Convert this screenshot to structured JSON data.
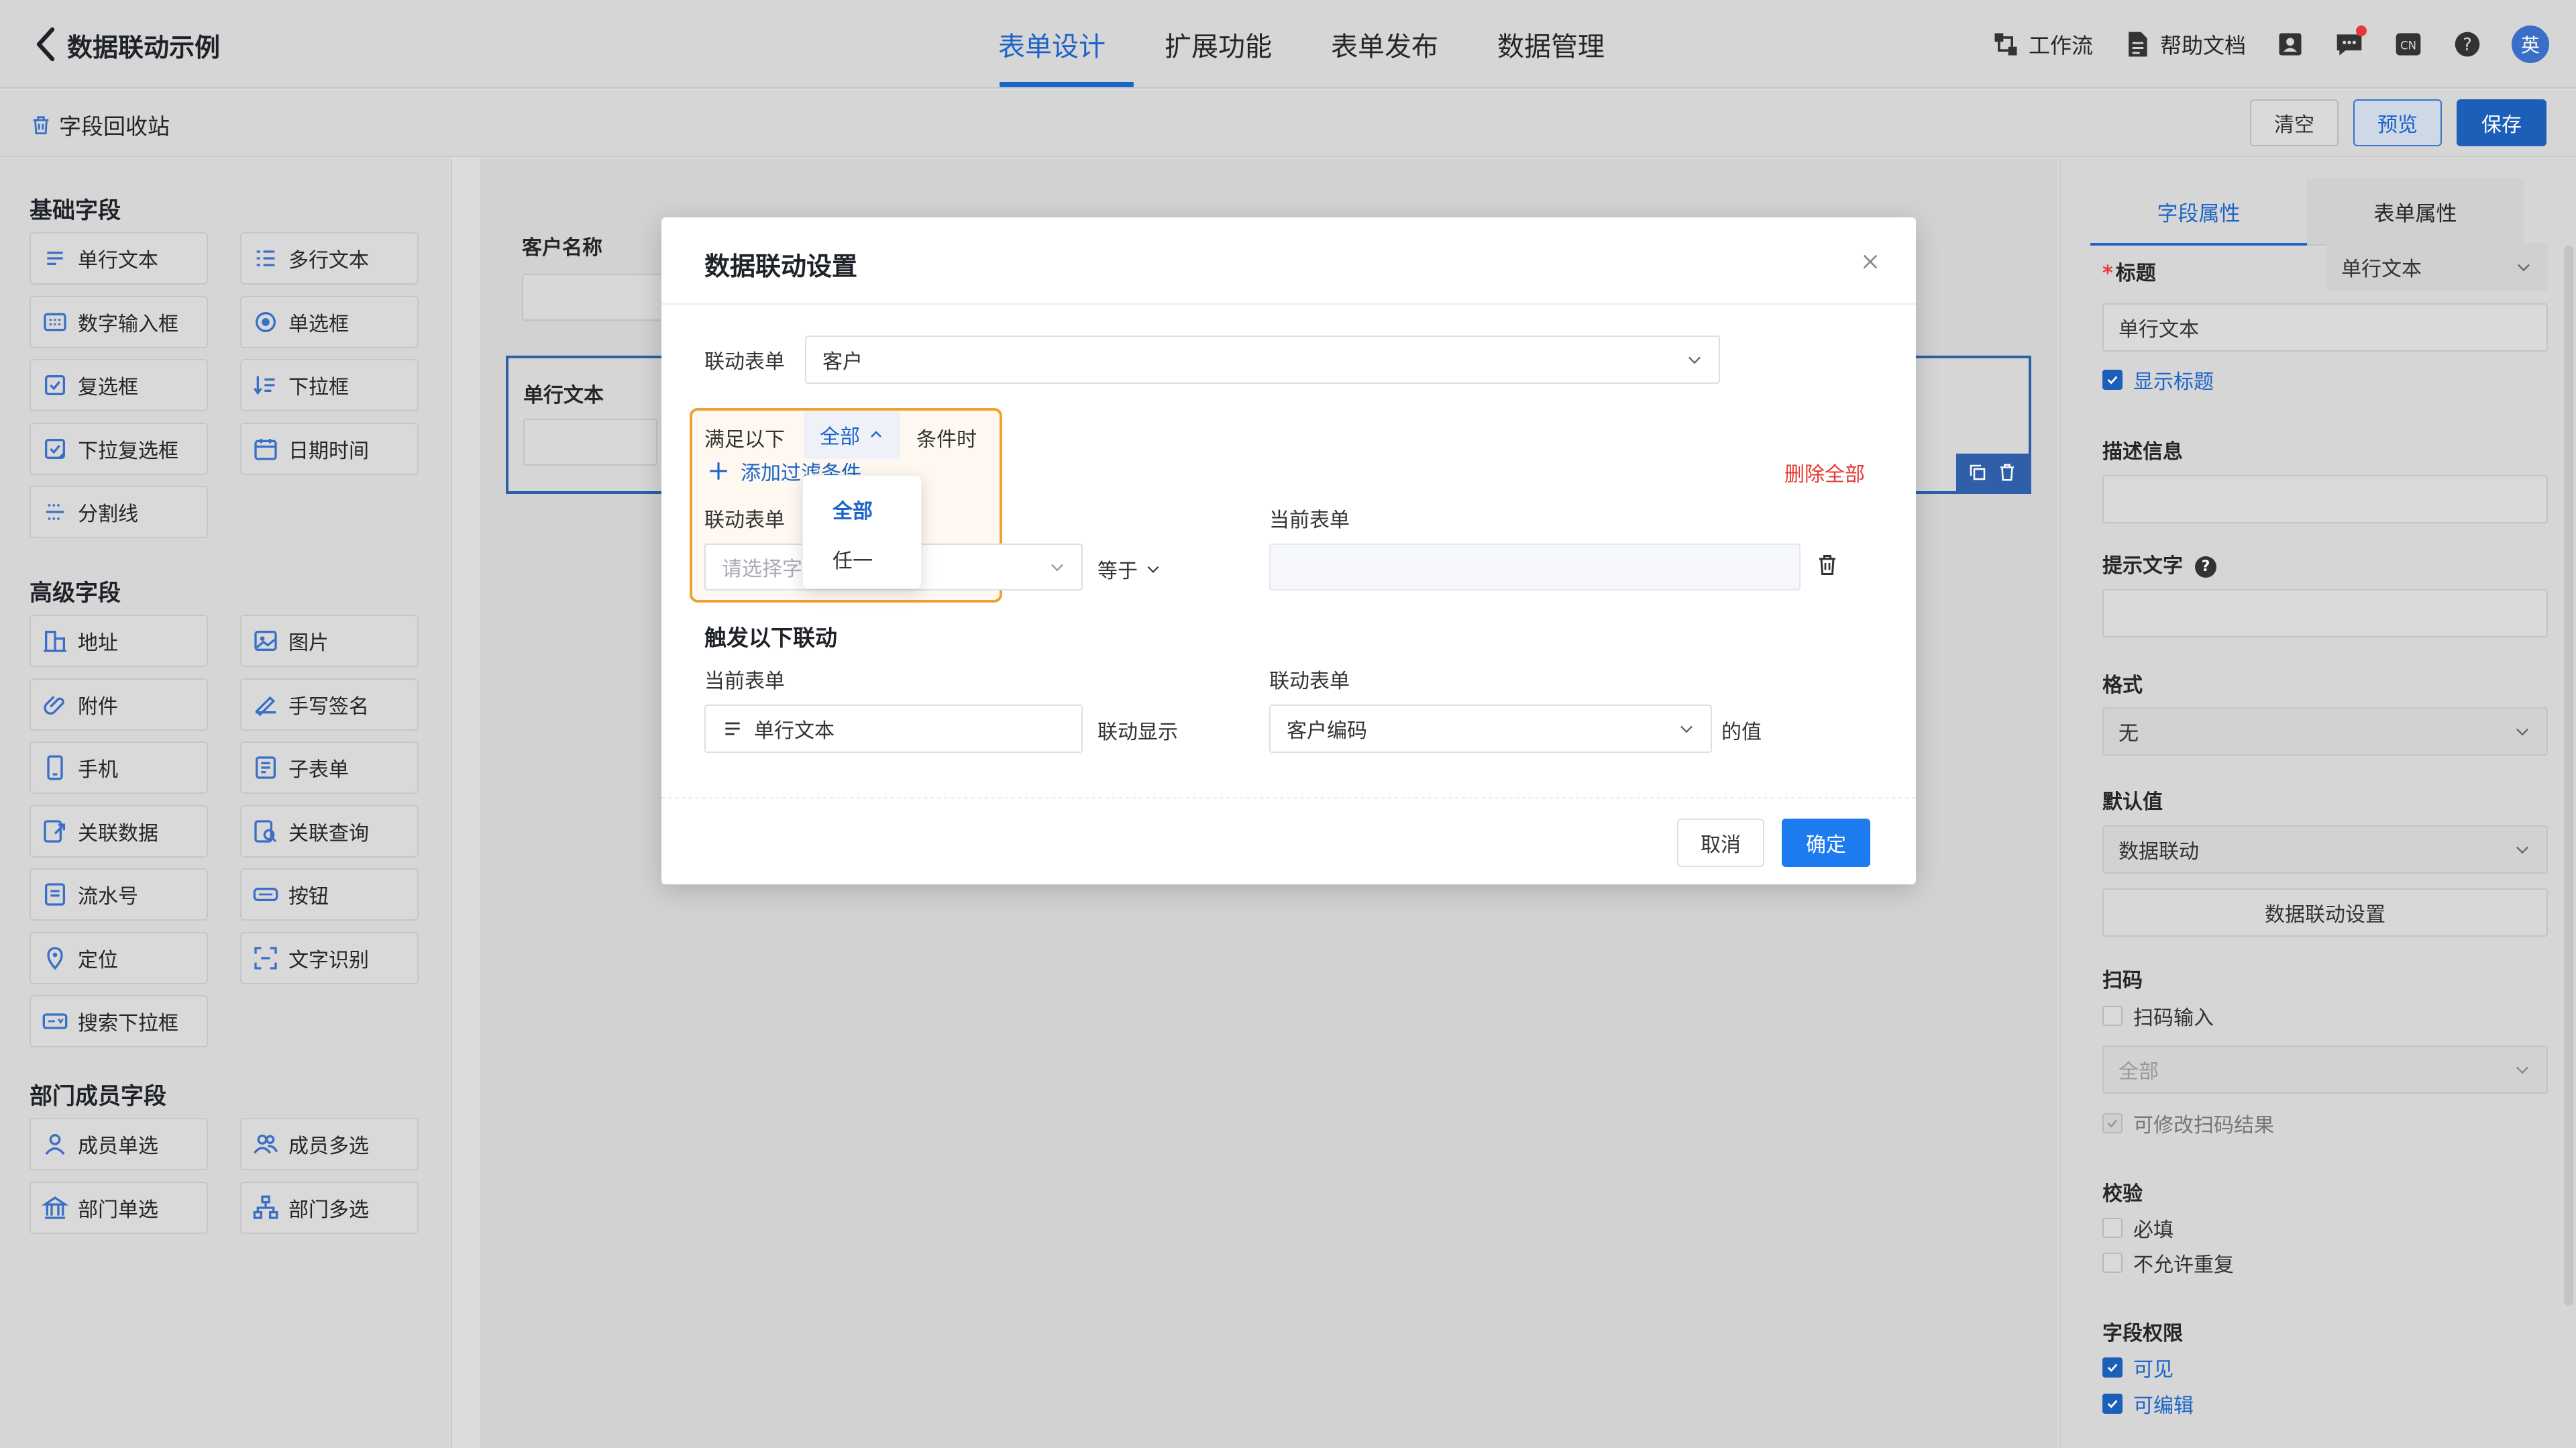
{
  "topbar": {
    "title": "数据联动示例",
    "tabs": [
      "表单设计",
      "扩展功能",
      "表单发布",
      "数据管理"
    ],
    "active_tab": 0,
    "workflow": "工作流",
    "help_docs": "帮助文档",
    "avatar": "英"
  },
  "subbar": {
    "recycle": "字段回收站",
    "clear": "清空",
    "preview": "预览",
    "save": "保存"
  },
  "left": {
    "groups": [
      {
        "title": "基础字段",
        "items": [
          {
            "label": "单行文本",
            "icon": "single-line-icon"
          },
          {
            "label": "多行文本",
            "icon": "multi-line-icon"
          },
          {
            "label": "数字输入框",
            "icon": "number-icon"
          },
          {
            "label": "单选框",
            "icon": "radio-icon"
          },
          {
            "label": "复选框",
            "icon": "checkbox-icon"
          },
          {
            "label": "下拉框",
            "icon": "dropdown-icon"
          },
          {
            "label": "下拉复选框",
            "icon": "multi-dropdown-icon"
          },
          {
            "label": "日期时间",
            "icon": "calendar-icon"
          },
          {
            "label": "分割线",
            "icon": "divider-icon"
          }
        ]
      },
      {
        "title": "高级字段",
        "items": [
          {
            "label": "地址",
            "icon": "address-icon"
          },
          {
            "label": "图片",
            "icon": "image-icon"
          },
          {
            "label": "附件",
            "icon": "attachment-icon"
          },
          {
            "label": "手写签名",
            "icon": "signature-icon"
          },
          {
            "label": "手机",
            "icon": "phone-icon"
          },
          {
            "label": "子表单",
            "icon": "subform-icon"
          },
          {
            "label": "关联数据",
            "icon": "link-data-icon"
          },
          {
            "label": "关联查询",
            "icon": "link-query-icon"
          },
          {
            "label": "流水号",
            "icon": "serial-icon"
          },
          {
            "label": "按钮",
            "icon": "button-icon"
          },
          {
            "label": "定位",
            "icon": "location-icon"
          },
          {
            "label": "文字识别",
            "icon": "ocr-icon"
          },
          {
            "label": "搜索下拉框",
            "icon": "search-dropdown-icon"
          }
        ]
      },
      {
        "title": "部门成员字段",
        "items": [
          {
            "label": "成员单选",
            "icon": "member-icon"
          },
          {
            "label": "成员多选",
            "icon": "members-icon"
          },
          {
            "label": "部门单选",
            "icon": "department-icon"
          },
          {
            "label": "部门多选",
            "icon": "departments-icon"
          }
        ]
      }
    ]
  },
  "canvas": {
    "field1_label": "客户名称",
    "field2_label": "单行文本"
  },
  "right": {
    "tabs": [
      "字段属性",
      "表单属性"
    ],
    "title_label": "标题",
    "title_type": "单行文本",
    "title_value": "单行文本",
    "show_title": "显示标题",
    "desc_label": "描述信息",
    "hint_label": "提示文字",
    "format_label": "格式",
    "format_value": "无",
    "default_label": "默认值",
    "default_value": "数据联动",
    "linkage_button": "数据联动设置",
    "scan_label": "扫码",
    "scan_input": "扫码输入",
    "scan_select": "全部",
    "scan_editable": "可修改扫码结果",
    "validate_label": "校验",
    "required": "必填",
    "no_duplicate": "不允许重复",
    "perm_label": "字段权限",
    "visible": "可见",
    "editable": "可编辑"
  },
  "modal": {
    "title": "数据联动设置",
    "linked_form_label": "联动表单",
    "linked_form_value": "客户",
    "satisfy": "满足以下",
    "cond_value": "全部",
    "cond_suffix": "条件时",
    "add_filter": "添加过滤条件",
    "delete_all": "删除全部",
    "col_linked": "联动表单",
    "col_current": "当前表单",
    "field_placeholder": "请选择字段",
    "equals": "等于",
    "trigger_title": "触发以下联动",
    "trig_current": "当前表单",
    "trig_linked": "联动表单",
    "current_field": "单行文本",
    "link_show": "联动显示",
    "linked_field": "客户编码",
    "value_of": "的值",
    "cancel": "取消",
    "confirm": "确定",
    "dropdown_options": [
      "全部",
      "任一"
    ]
  }
}
